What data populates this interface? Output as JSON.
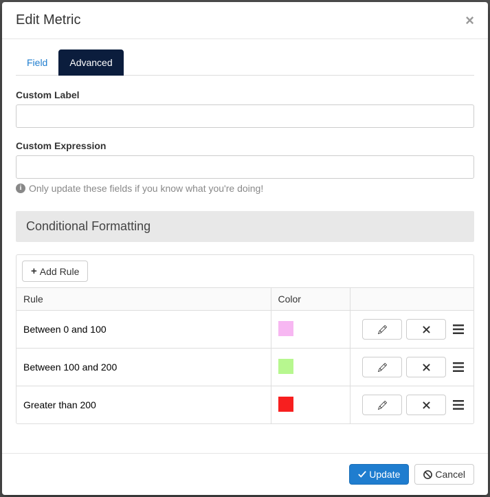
{
  "modal": {
    "title": "Edit Metric"
  },
  "tabs": {
    "field": "Field",
    "advanced": "Advanced"
  },
  "form": {
    "customLabel": {
      "label": "Custom Label",
      "value": ""
    },
    "customExpression": {
      "label": "Custom Expression",
      "value": ""
    },
    "helpText": "Only update these fields if you know what you're doing!"
  },
  "conditional": {
    "heading": "Conditional Formatting",
    "addRuleLabel": "Add Rule",
    "columns": {
      "rule": "Rule",
      "color": "Color"
    },
    "rules": [
      {
        "label": "Between 0 and 100",
        "color": "#f7b7f2"
      },
      {
        "label": "Between 100 and 200",
        "color": "#b7f78f"
      },
      {
        "label": "Greater than 200",
        "color": "#f71f1f"
      }
    ]
  },
  "footer": {
    "update": "Update",
    "cancel": "Cancel"
  }
}
